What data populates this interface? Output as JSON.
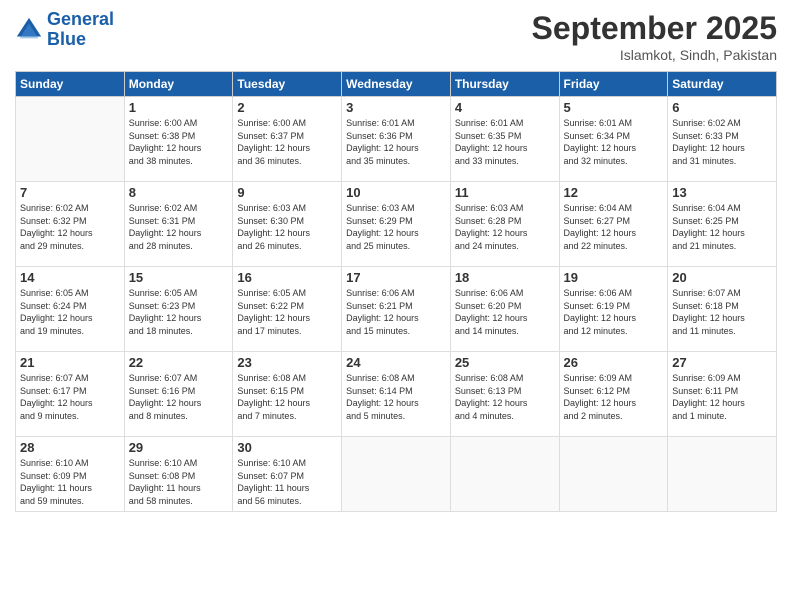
{
  "header": {
    "logo_line1": "General",
    "logo_line2": "Blue",
    "month": "September 2025",
    "location": "Islamkot, Sindh, Pakistan"
  },
  "days_of_week": [
    "Sunday",
    "Monday",
    "Tuesday",
    "Wednesday",
    "Thursday",
    "Friday",
    "Saturday"
  ],
  "weeks": [
    [
      {
        "day": "",
        "info": ""
      },
      {
        "day": "1",
        "info": "Sunrise: 6:00 AM\nSunset: 6:38 PM\nDaylight: 12 hours\nand 38 minutes."
      },
      {
        "day": "2",
        "info": "Sunrise: 6:00 AM\nSunset: 6:37 PM\nDaylight: 12 hours\nand 36 minutes."
      },
      {
        "day": "3",
        "info": "Sunrise: 6:01 AM\nSunset: 6:36 PM\nDaylight: 12 hours\nand 35 minutes."
      },
      {
        "day": "4",
        "info": "Sunrise: 6:01 AM\nSunset: 6:35 PM\nDaylight: 12 hours\nand 33 minutes."
      },
      {
        "day": "5",
        "info": "Sunrise: 6:01 AM\nSunset: 6:34 PM\nDaylight: 12 hours\nand 32 minutes."
      },
      {
        "day": "6",
        "info": "Sunrise: 6:02 AM\nSunset: 6:33 PM\nDaylight: 12 hours\nand 31 minutes."
      }
    ],
    [
      {
        "day": "7",
        "info": "Sunrise: 6:02 AM\nSunset: 6:32 PM\nDaylight: 12 hours\nand 29 minutes."
      },
      {
        "day": "8",
        "info": "Sunrise: 6:02 AM\nSunset: 6:31 PM\nDaylight: 12 hours\nand 28 minutes."
      },
      {
        "day": "9",
        "info": "Sunrise: 6:03 AM\nSunset: 6:30 PM\nDaylight: 12 hours\nand 26 minutes."
      },
      {
        "day": "10",
        "info": "Sunrise: 6:03 AM\nSunset: 6:29 PM\nDaylight: 12 hours\nand 25 minutes."
      },
      {
        "day": "11",
        "info": "Sunrise: 6:03 AM\nSunset: 6:28 PM\nDaylight: 12 hours\nand 24 minutes."
      },
      {
        "day": "12",
        "info": "Sunrise: 6:04 AM\nSunset: 6:27 PM\nDaylight: 12 hours\nand 22 minutes."
      },
      {
        "day": "13",
        "info": "Sunrise: 6:04 AM\nSunset: 6:25 PM\nDaylight: 12 hours\nand 21 minutes."
      }
    ],
    [
      {
        "day": "14",
        "info": "Sunrise: 6:05 AM\nSunset: 6:24 PM\nDaylight: 12 hours\nand 19 minutes."
      },
      {
        "day": "15",
        "info": "Sunrise: 6:05 AM\nSunset: 6:23 PM\nDaylight: 12 hours\nand 18 minutes."
      },
      {
        "day": "16",
        "info": "Sunrise: 6:05 AM\nSunset: 6:22 PM\nDaylight: 12 hours\nand 17 minutes."
      },
      {
        "day": "17",
        "info": "Sunrise: 6:06 AM\nSunset: 6:21 PM\nDaylight: 12 hours\nand 15 minutes."
      },
      {
        "day": "18",
        "info": "Sunrise: 6:06 AM\nSunset: 6:20 PM\nDaylight: 12 hours\nand 14 minutes."
      },
      {
        "day": "19",
        "info": "Sunrise: 6:06 AM\nSunset: 6:19 PM\nDaylight: 12 hours\nand 12 minutes."
      },
      {
        "day": "20",
        "info": "Sunrise: 6:07 AM\nSunset: 6:18 PM\nDaylight: 12 hours\nand 11 minutes."
      }
    ],
    [
      {
        "day": "21",
        "info": "Sunrise: 6:07 AM\nSunset: 6:17 PM\nDaylight: 12 hours\nand 9 minutes."
      },
      {
        "day": "22",
        "info": "Sunrise: 6:07 AM\nSunset: 6:16 PM\nDaylight: 12 hours\nand 8 minutes."
      },
      {
        "day": "23",
        "info": "Sunrise: 6:08 AM\nSunset: 6:15 PM\nDaylight: 12 hours\nand 7 minutes."
      },
      {
        "day": "24",
        "info": "Sunrise: 6:08 AM\nSunset: 6:14 PM\nDaylight: 12 hours\nand 5 minutes."
      },
      {
        "day": "25",
        "info": "Sunrise: 6:08 AM\nSunset: 6:13 PM\nDaylight: 12 hours\nand 4 minutes."
      },
      {
        "day": "26",
        "info": "Sunrise: 6:09 AM\nSunset: 6:12 PM\nDaylight: 12 hours\nand 2 minutes."
      },
      {
        "day": "27",
        "info": "Sunrise: 6:09 AM\nSunset: 6:11 PM\nDaylight: 12 hours\nand 1 minute."
      }
    ],
    [
      {
        "day": "28",
        "info": "Sunrise: 6:10 AM\nSunset: 6:09 PM\nDaylight: 11 hours\nand 59 minutes."
      },
      {
        "day": "29",
        "info": "Sunrise: 6:10 AM\nSunset: 6:08 PM\nDaylight: 11 hours\nand 58 minutes."
      },
      {
        "day": "30",
        "info": "Sunrise: 6:10 AM\nSunset: 6:07 PM\nDaylight: 11 hours\nand 56 minutes."
      },
      {
        "day": "",
        "info": ""
      },
      {
        "day": "",
        "info": ""
      },
      {
        "day": "",
        "info": ""
      },
      {
        "day": "",
        "info": ""
      }
    ]
  ]
}
